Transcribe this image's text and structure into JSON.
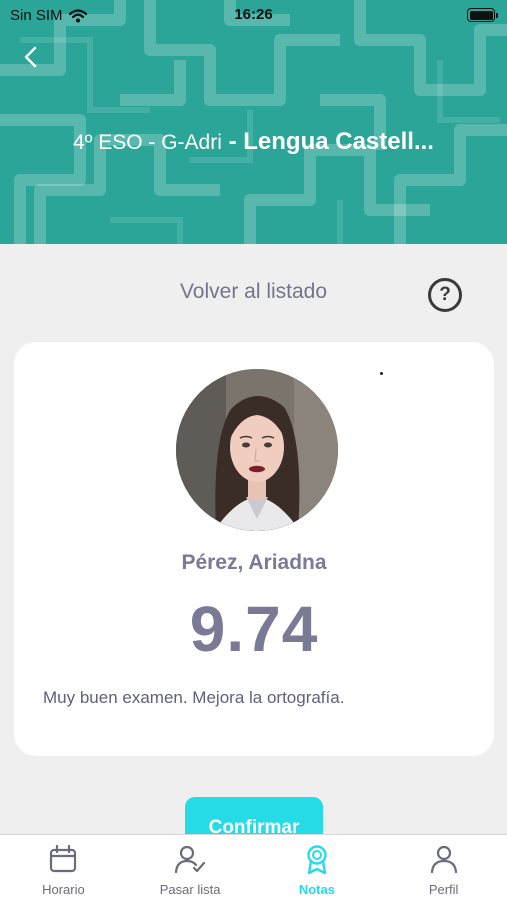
{
  "status_bar": {
    "carrier": "Sin SIM",
    "time": "16:26"
  },
  "header": {
    "group": "4º ESO - G-Adri",
    "separator": " - ",
    "subject": "Lengua Castell...",
    "background_color": "#2ba597"
  },
  "nav": {
    "return_label": "Volver al listado",
    "help_label": "?"
  },
  "student": {
    "name": "Pérez, Ariadna",
    "grade": "9.74",
    "comment": "Muy buen examen. Mejora la ortografía."
  },
  "actions": {
    "confirm_label": "Confirmar",
    "confirm_color": "#27dbe6"
  },
  "tab_bar": {
    "tabs": [
      {
        "label": "Horario",
        "icon": "calendar-icon",
        "active": false
      },
      {
        "label": "Pasar lista",
        "icon": "user-check-icon",
        "active": false
      },
      {
        "label": "Notas",
        "icon": "award-ribbon-icon",
        "active": true
      },
      {
        "label": "Perfil",
        "icon": "user-icon",
        "active": false
      }
    ],
    "active_color": "#27dbe6"
  }
}
